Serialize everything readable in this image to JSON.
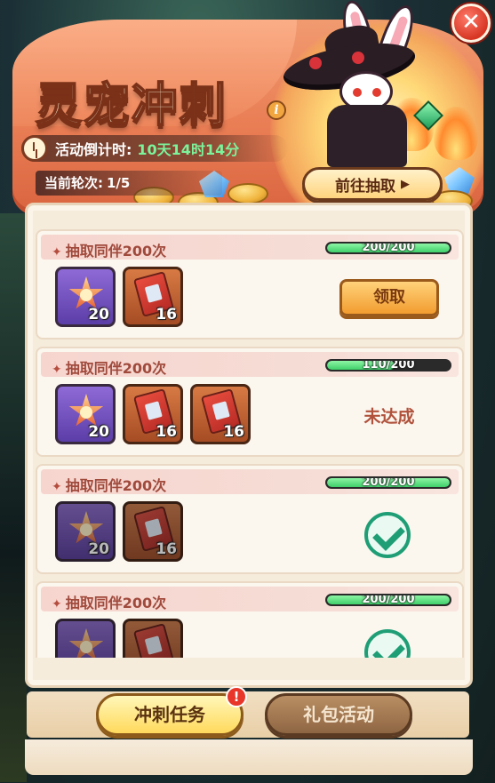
{
  "header": {
    "title": "灵宠冲刺",
    "countdown_label": "活动倒计时:",
    "countdown_value": "10天14时14分",
    "round_label": "当前轮次:",
    "round_value": "1/5",
    "go_draw_label": "前往抽取"
  },
  "tasks": [
    {
      "title": "抽取同伴200次",
      "progress_text": "200/200",
      "progress_fraction": 1.0,
      "rewards": [
        {
          "icon": "star-medal-icon",
          "qty": "20",
          "frame": "purple"
        },
        {
          "icon": "ticket-bundle-icon",
          "qty": "16",
          "frame": "brown"
        }
      ],
      "state": "claim",
      "action_label": "领取"
    },
    {
      "title": "抽取同伴200次",
      "progress_text": "110/200",
      "progress_fraction": 0.55,
      "rewards": [
        {
          "icon": "star-medal-icon",
          "qty": "20",
          "frame": "purple"
        },
        {
          "icon": "ticket-bundle-icon",
          "qty": "16",
          "frame": "brown"
        },
        {
          "icon": "ticket-bundle-icon",
          "qty": "16",
          "frame": "brown"
        }
      ],
      "state": "incomplete",
      "action_label": "未达成"
    },
    {
      "title": "抽取同伴200次",
      "progress_text": "200/200",
      "progress_fraction": 1.0,
      "rewards": [
        {
          "icon": "star-medal-icon",
          "qty": "20",
          "frame": "purple"
        },
        {
          "icon": "ticket-bundle-icon",
          "qty": "16",
          "frame": "brown"
        }
      ],
      "state": "claimed",
      "action_label": ""
    },
    {
      "title": "抽取同伴200次",
      "progress_text": "200/200",
      "progress_fraction": 1.0,
      "rewards": [
        {
          "icon": "star-medal-icon",
          "qty": "",
          "frame": "purple"
        },
        {
          "icon": "ticket-bundle-icon",
          "qty": "",
          "frame": "brown"
        }
      ],
      "state": "claimed",
      "action_label": ""
    }
  ],
  "tabs": {
    "active_label": "冲刺任务",
    "inactive_label": "礼包活动",
    "badge": "!"
  },
  "close_icon": "close-icon",
  "colors": {
    "progress_fill": "#3fcf6a",
    "claim_button": "#f29c2f",
    "check": "#1f9e76",
    "header": "#e97d54"
  }
}
